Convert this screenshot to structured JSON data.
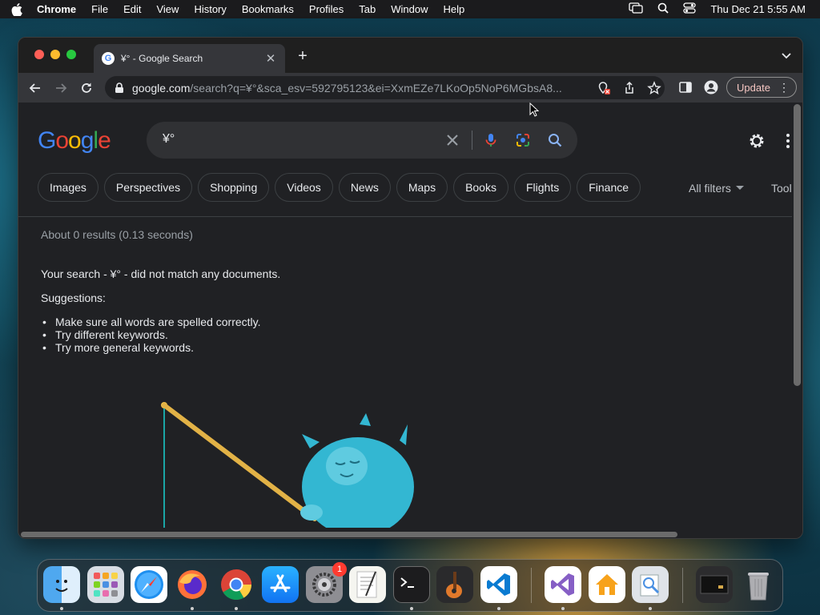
{
  "menubar": {
    "app": "Chrome",
    "items": [
      "File",
      "Edit",
      "View",
      "History",
      "Bookmarks",
      "Profiles",
      "Tab",
      "Window",
      "Help"
    ],
    "clock": "Thu Dec 21  5:55 AM",
    "icons": [
      "apple-icon",
      "screen-mirror-icon",
      "spotlight-search-icon",
      "control-center-icon"
    ]
  },
  "browser": {
    "tab_title": "¥° - Google Search",
    "url_host": "google.com",
    "url_path": "/search?q=¥°&sca_esv=592795123&ei=XxmEZe7LKoOp5NoP6MGbsA8...",
    "update_label": "Update"
  },
  "search": {
    "query": "¥°",
    "logo_letters": [
      "G",
      "o",
      "o",
      "g",
      "l",
      "e"
    ],
    "logo_colors": [
      "#4285f4",
      "#ea4335",
      "#fbbc05",
      "#4285f4",
      "#34a853",
      "#ea4335"
    ],
    "chips": [
      "Images",
      "Perspectives",
      "Shopping",
      "Videos",
      "News",
      "Maps",
      "Books",
      "Flights",
      "Finance"
    ],
    "all_filters": "All filters",
    "tools": "Tool"
  },
  "results": {
    "stats": "About 0 results (0.13 seconds)",
    "no_match": "Your search - ¥° - did not match any documents.",
    "suggestions_label": "Suggestions:",
    "suggestions": [
      "Make sure all words are spelled correctly.",
      "Try different keywords.",
      "Try more general keywords."
    ]
  },
  "dock": {
    "apps": [
      "Finder",
      "Launchpad",
      "Safari",
      "Firefox",
      "Chrome",
      "App Store",
      "System Settings",
      "TextEdit",
      "Terminal",
      "GarageBand",
      "Visual Studio Code",
      "Visual Studio",
      "Home",
      "Preview",
      "Screenshot",
      "Trash"
    ],
    "settings_badge": "1"
  }
}
